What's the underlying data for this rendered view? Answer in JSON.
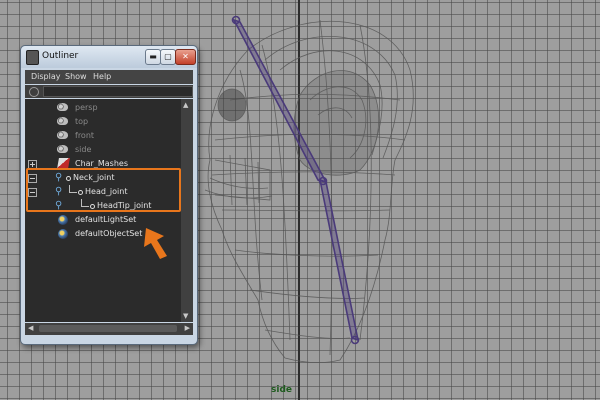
{
  "viewport": {
    "camera_label": "side"
  },
  "outliner": {
    "title": "Outliner",
    "window_buttons": {
      "minimize": "▬",
      "maximize": "▢",
      "close": "✕"
    },
    "menu": {
      "display": "Display",
      "show": "Show",
      "help": "Help"
    },
    "search": {
      "value": ""
    },
    "items": [
      {
        "label": "persp",
        "icon": "camera-icon",
        "state": "hidden"
      },
      {
        "label": "top",
        "icon": "camera-icon",
        "state": "hidden"
      },
      {
        "label": "front",
        "icon": "camera-icon",
        "state": "hidden"
      },
      {
        "label": "side",
        "icon": "camera-icon",
        "state": "hidden"
      },
      {
        "label": "Char_Mashes",
        "icon": "mesh-icon",
        "state": "visible"
      },
      {
        "label": "Neck_joint",
        "icon": "joint-icon",
        "state": "visible"
      },
      {
        "label": "Head_joint",
        "icon": "joint-icon",
        "state": "visible"
      },
      {
        "label": "HeadTip_joint",
        "icon": "joint-icon",
        "state": "visible"
      },
      {
        "label": "defaultLightSet",
        "icon": "set-icon",
        "state": "visible"
      },
      {
        "label": "defaultObjectSet",
        "icon": "set-icon",
        "state": "visible"
      }
    ]
  },
  "colors": {
    "highlight": "#e8761c",
    "joint_chain": "#4a3a7a",
    "grid_background": "#9e9e9e"
  }
}
